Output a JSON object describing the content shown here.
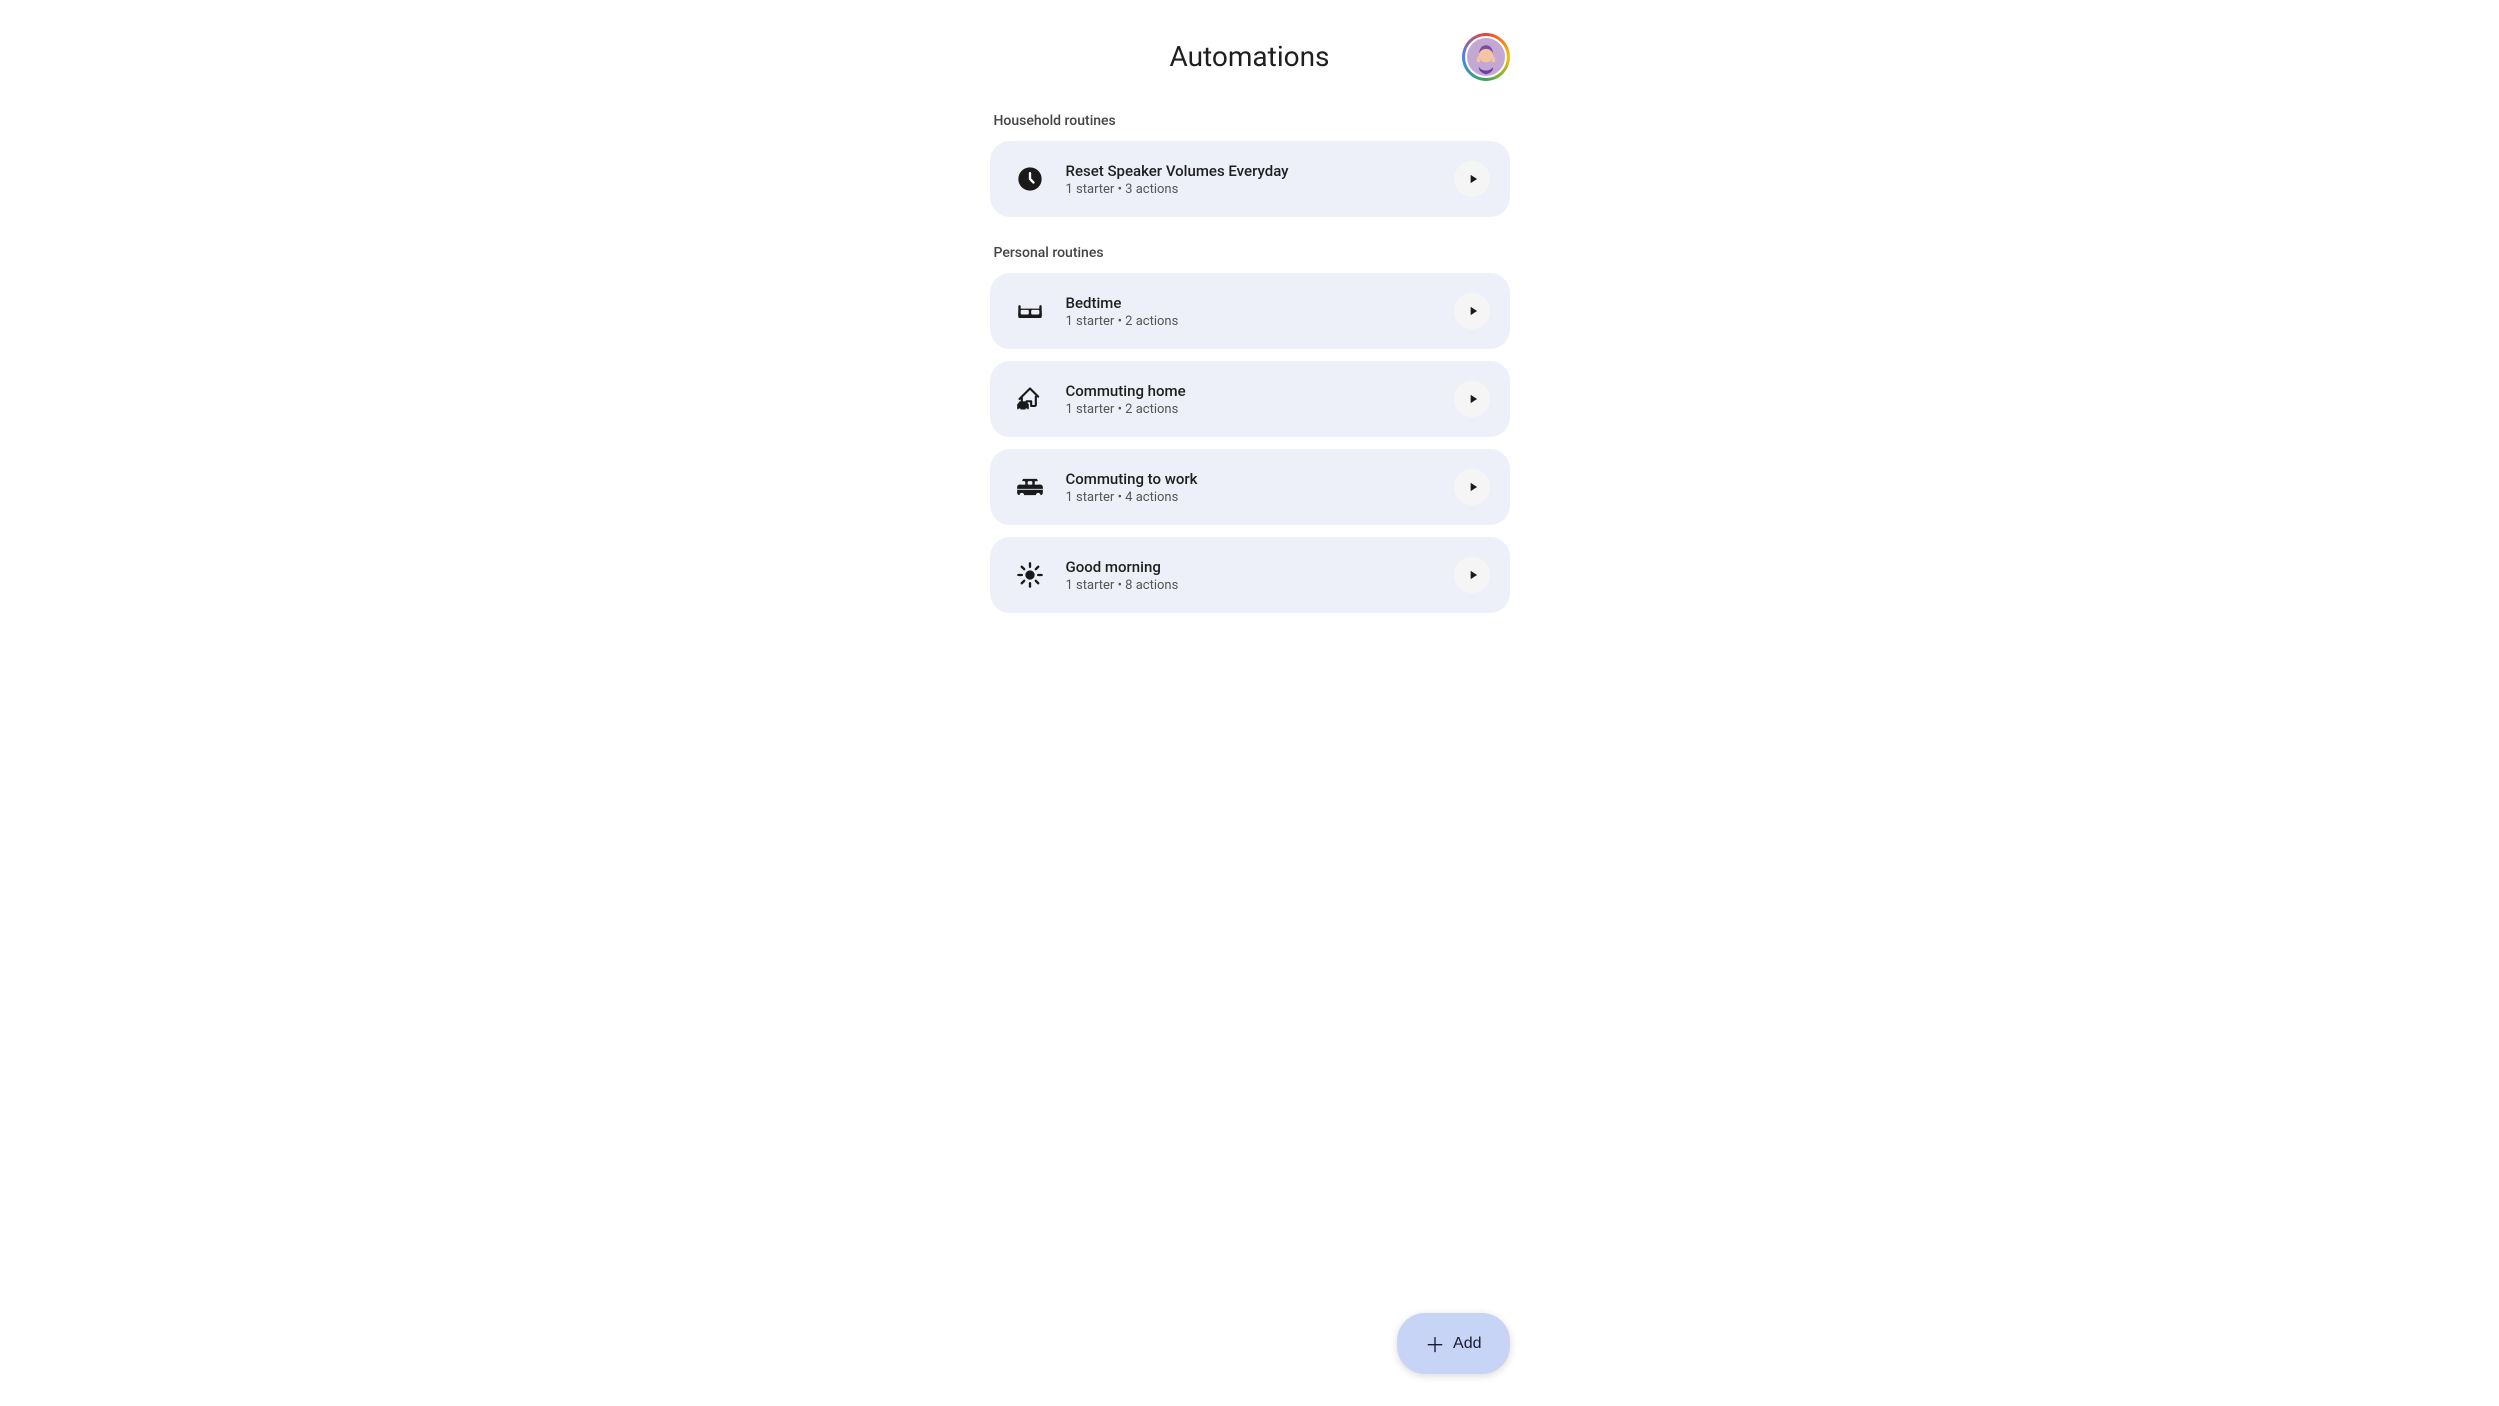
{
  "header": {
    "title": "Automations"
  },
  "sections": [
    {
      "id": "household",
      "label": "Household routines",
      "routines": [
        {
          "id": "reset-speaker",
          "name": "Reset Speaker Volumes Everyday",
          "meta": "1 starter • 3 actions",
          "icon": "clock"
        }
      ]
    },
    {
      "id": "personal",
      "label": "Personal routines",
      "routines": [
        {
          "id": "bedtime",
          "name": "Bedtime",
          "meta": "1 starter • 2 actions",
          "icon": "bed"
        },
        {
          "id": "commuting-home",
          "name": "Commuting home",
          "meta": "1 starter • 2 actions",
          "icon": "car-home"
        },
        {
          "id": "commuting-work",
          "name": "Commuting to work",
          "meta": "1 starter • 4 actions",
          "icon": "car-work"
        },
        {
          "id": "good-morning",
          "name": "Good morning",
          "meta": "1 starter • 8 actions",
          "icon": "sun"
        }
      ]
    }
  ],
  "add_button": {
    "label": "Add"
  }
}
